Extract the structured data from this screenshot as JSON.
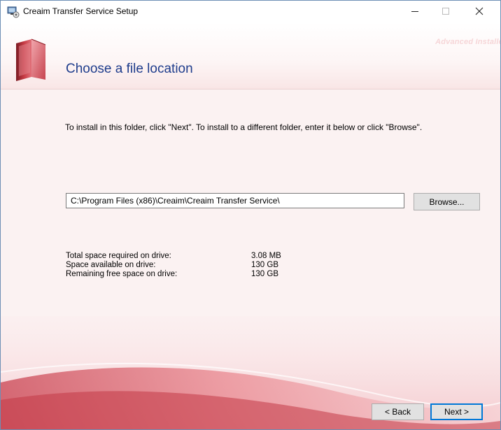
{
  "window": {
    "title": "Creaim Transfer Service Setup",
    "controls": {
      "minimize": "minimize-icon",
      "maximize": "maximize-icon",
      "close": "close-icon"
    }
  },
  "header": {
    "watermark": "Advanced Installe",
    "title": "Choose a file location",
    "icon": "folder-book-icon"
  },
  "main": {
    "instruction": "To install in this folder, click \"Next\". To install to a different folder, enter it below or click \"Browse\".",
    "path_value": "C:\\Program Files (x86)\\Creaim\\Creaim Transfer Service\\",
    "browse_label": "Browse...",
    "space": [
      {
        "label": "Total space required on drive:",
        "value": "3.08 MB"
      },
      {
        "label": "Space available on drive:",
        "value": "130 GB"
      },
      {
        "label": "Remaining free space on drive:",
        "value": "130 GB"
      }
    ]
  },
  "footer": {
    "back_label": "< Back",
    "next_label": "Next >"
  },
  "colors": {
    "title_blue": "#1f3d8c",
    "accent_red": "#d24a55",
    "focus_blue": "#0078d7"
  }
}
